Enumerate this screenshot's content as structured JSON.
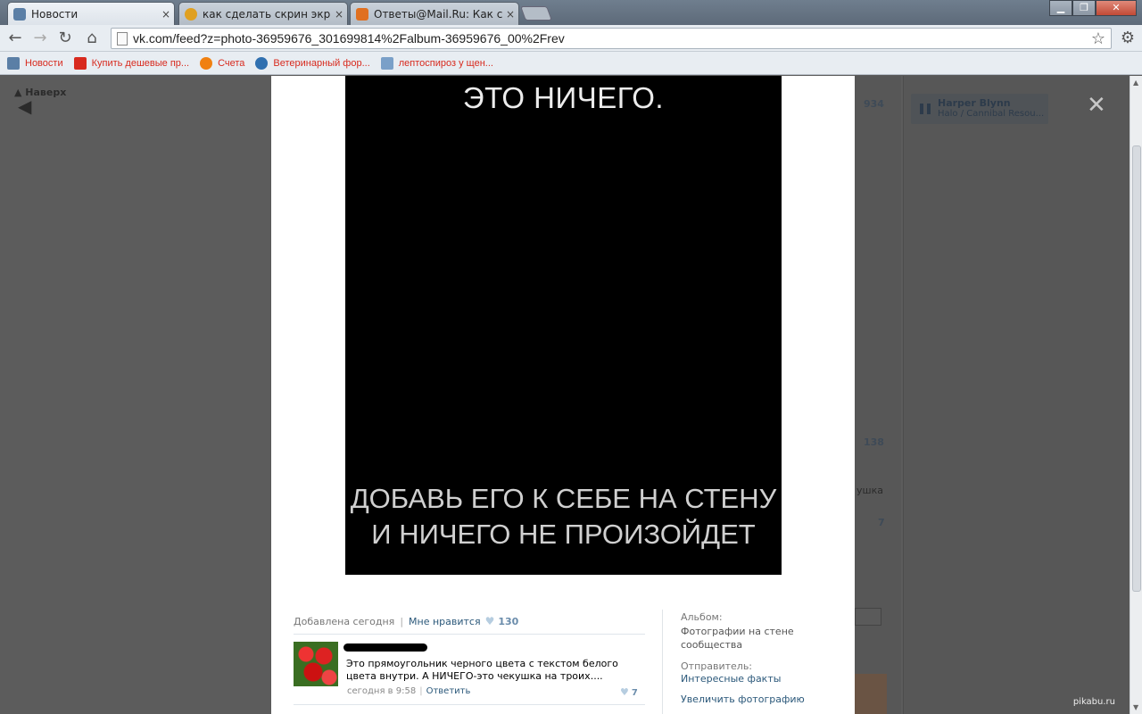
{
  "browser": {
    "tabs": [
      {
        "title": "Новости",
        "close": "×",
        "favicon_color": "#5b7fa6"
      },
      {
        "title": "как сделать скрин экрана",
        "close": "×",
        "favicon_color": "#e0a020"
      },
      {
        "title": "Ответы@Mail.Ru: Как сде",
        "close": "×",
        "favicon_color": "#e07020"
      }
    ],
    "window_buttons": {
      "minimize": "▁",
      "maximize": "❐",
      "close": "✕"
    },
    "url": "vk.com/feed?z=photo-36959676_301699814%2Falbum-36959676_00%2Frev",
    "bookmarks": [
      {
        "label": "Новости",
        "icon_color": "#5b7fa6"
      },
      {
        "label": "Купить дешевые пр...",
        "icon_color": "#d82a1e"
      },
      {
        "label": "Счета",
        "icon_color": "#f08010"
      },
      {
        "label": "Ветеринарный фор...",
        "icon_color": "#3070b0"
      },
      {
        "label": "лептоспироз у щен...",
        "icon_color": "#7aa0c8"
      }
    ]
  },
  "page": {
    "back_top": "▲ Наверх",
    "bg_counts": [
      "934",
      "138",
      "7"
    ],
    "bg_snippet": "ушка",
    "player": {
      "artist": "Harper Blynn",
      "track": "Halo / Cannibal Resou..."
    },
    "close_icon": "✕",
    "watermark": "pikabu.ru"
  },
  "photo": {
    "top_text": "ЭТО НИЧЕГО.",
    "bottom_line1": "ДОБАВЬ ЕГО К СЕБЕ НА СТЕНУ",
    "bottom_line2": "И НИЧЕГО НЕ ПРОИЗОЙДЕТ"
  },
  "photo_info": {
    "added": "Добавлена сегодня",
    "like_label": "Мне нравится",
    "like_count": "130"
  },
  "comment": {
    "text": "Это прямоугольник черного цвета с текстом белого цвета внутри. А НИЧЕГО-это чекушка на троих....",
    "time": "сегодня в 9:58",
    "reply": "Ответить",
    "likes": "7"
  },
  "sidebar": {
    "album_label": "Альбом:",
    "album_value": "Фотографии на стене сообщества",
    "sender_label": "Отправитель:",
    "sender_value": "Интересные факты",
    "enlarge": "Увеличить фотографию"
  }
}
